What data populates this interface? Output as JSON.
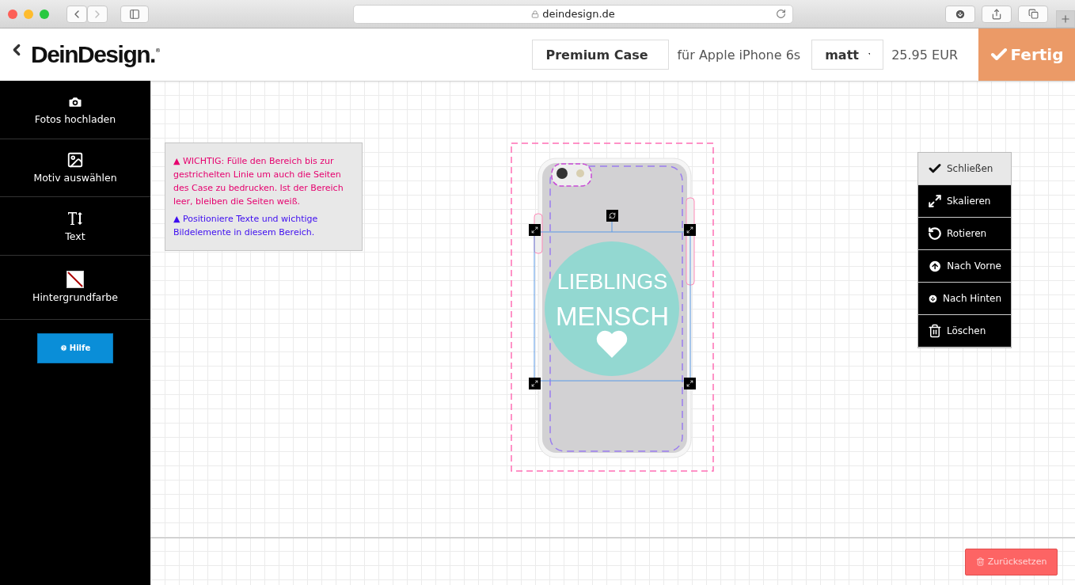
{
  "browser": {
    "url": "deindesign.de"
  },
  "header": {
    "logo": "DeinDesign.",
    "logo_mark": "®",
    "product": "Premium Case",
    "device": "für Apple iPhone 6s",
    "finish": "matt",
    "price": "25.95 EUR",
    "done_button": "Fertig"
  },
  "sidebar": {
    "items": [
      {
        "kind": "camera",
        "label": "Fotos hochladen"
      },
      {
        "kind": "image",
        "label": "Motiv auswählen"
      },
      {
        "kind": "text",
        "label": "Text"
      },
      {
        "kind": "background",
        "label": "Hintergrundfarbe"
      }
    ],
    "help_button": "Hilfe"
  },
  "notice": {
    "lines": [
      {
        "text": "▲ WICHTIG: Fülle den Bereich bis zur gestrichelten Linie um auch die Seiten des Case zu bedrucken. Ist der Bereich leer, bleiben die Seiten weiß.",
        "color": "#e6006e"
      },
      {
        "text": "▲ Positioniere Texte und wichtige Bildelemente in diesem Bereich.",
        "color": "#3d0cf0"
      }
    ]
  },
  "design": {
    "lines": [
      "LIEBLINGS",
      "MENSCH"
    ]
  },
  "tool_menu": {
    "items": [
      {
        "kind": "close",
        "label": "Schließen",
        "selected": true
      },
      {
        "kind": "scale",
        "label": "Skalieren",
        "selected": false
      },
      {
        "kind": "rotate",
        "label": "Rotieren",
        "selected": false
      },
      {
        "kind": "front",
        "label": "Nach Vorne",
        "selected": false
      },
      {
        "kind": "back",
        "label": "Nach Hinten",
        "selected": false
      },
      {
        "kind": "delete",
        "label": "Löschen",
        "selected": false
      }
    ]
  },
  "reset_button": "Zurücksetzen"
}
